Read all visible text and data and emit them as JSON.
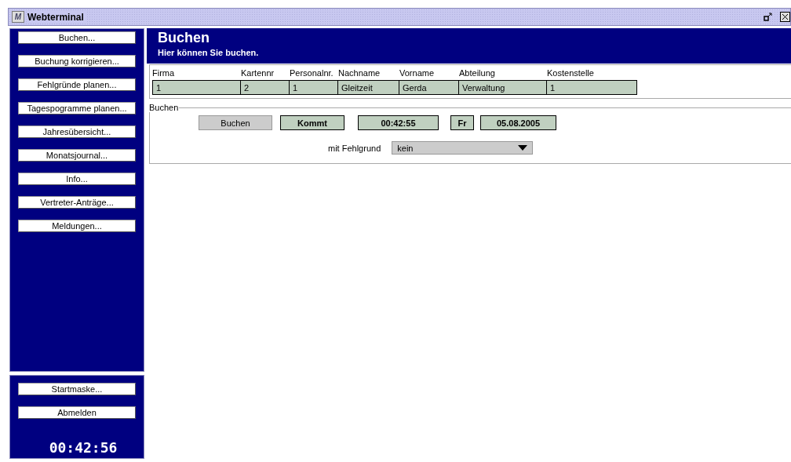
{
  "window": {
    "title": "Webterminal",
    "app_icon": "M"
  },
  "sidebar": {
    "items": [
      "Buchen...",
      "Buchung korrigieren...",
      "Fehlgründe planen...",
      "Tagespogramme planen...",
      "Jahresübersicht...",
      "Monatsjournal...",
      "Info...",
      "Vertreter-Anträge...",
      "Meldungen..."
    ],
    "bottom_items": [
      "Startmaske...",
      "Abmelden"
    ],
    "clock": "00:42:56"
  },
  "header": {
    "title": "Buchen",
    "subtitle": "Hier können Sie buchen."
  },
  "employee": {
    "columns": [
      "Firma",
      "Kartennr",
      "Personalnr.",
      "Nachname",
      "Vorname",
      "Abteilung",
      "Kostenstelle"
    ],
    "values": [
      "1",
      "2",
      "1",
      "Gleitzeit",
      "Gerda",
      "Verwaltung",
      "1"
    ]
  },
  "booking": {
    "legend": "Buchen",
    "button": "Buchen",
    "direction": "Kommt",
    "time": "00:42:55",
    "weekday": "Fr",
    "date": "05.08.2005",
    "reason_label": "mit Fehlgrund",
    "reason_value": "kein"
  }
}
